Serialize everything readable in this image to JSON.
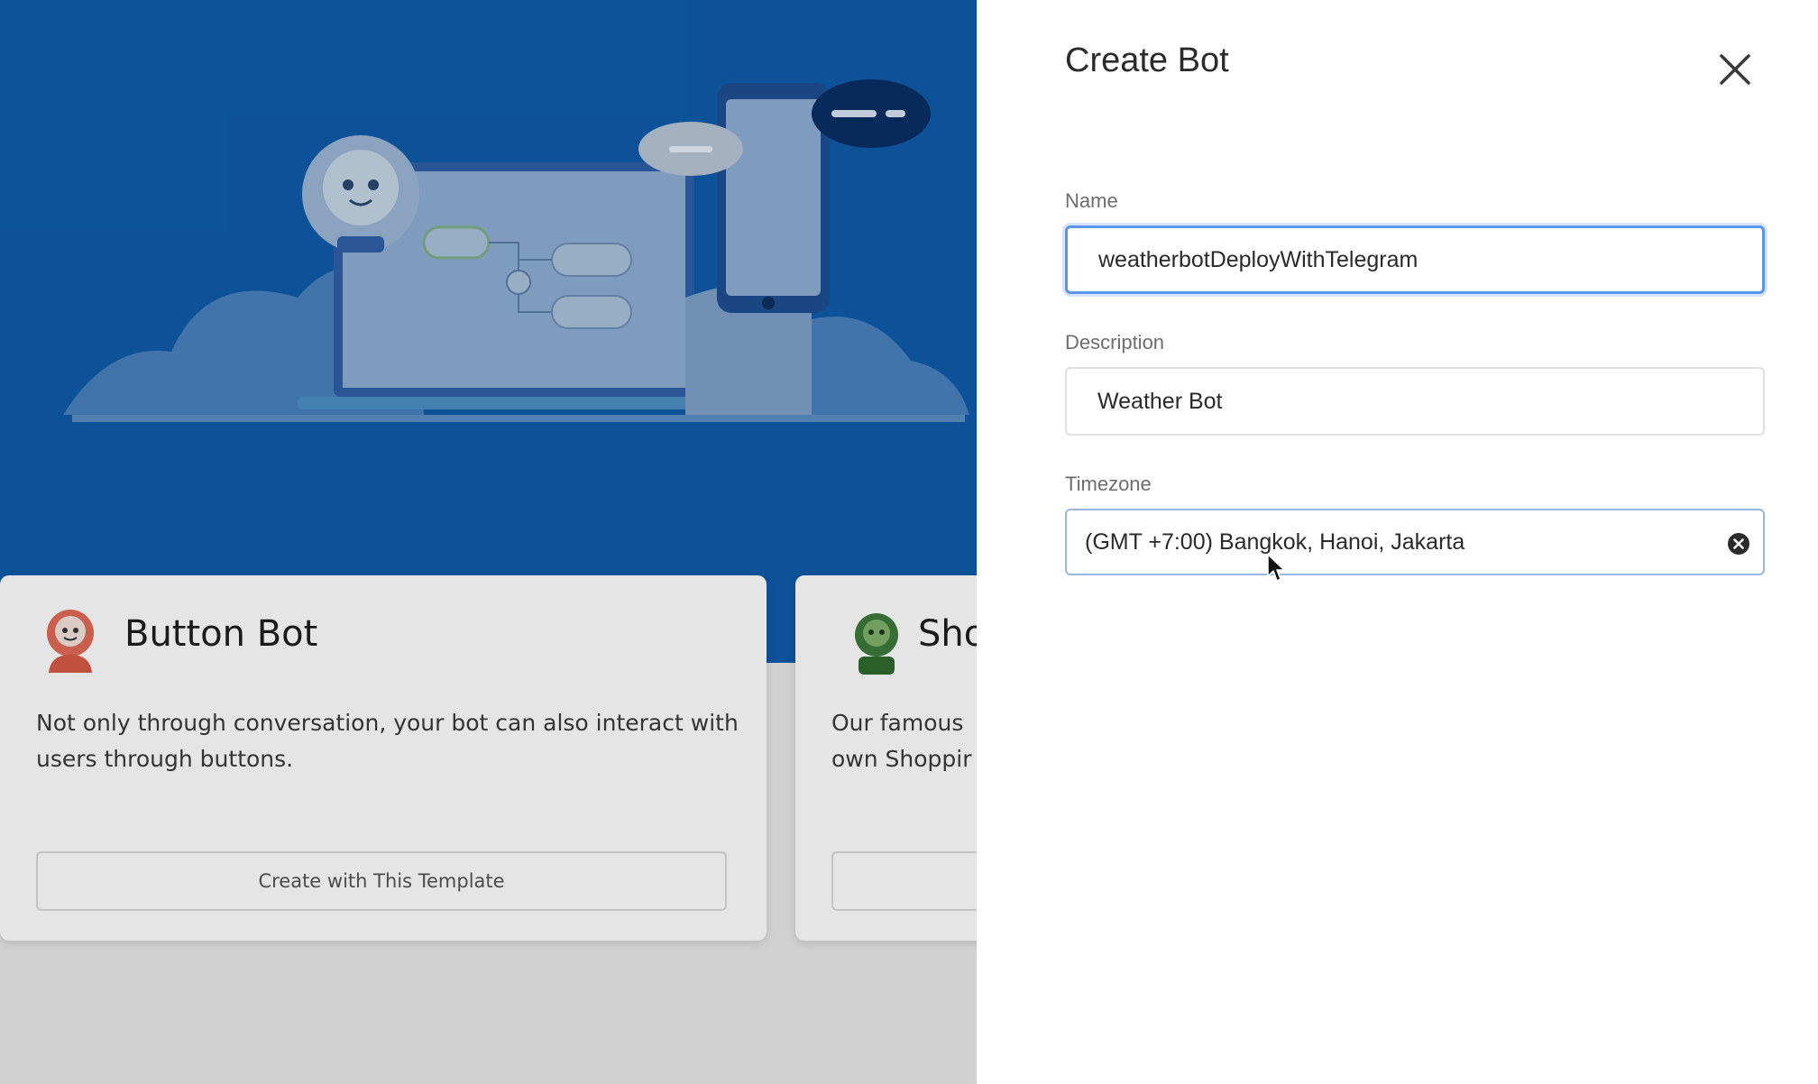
{
  "templates": [
    {
      "title": "Button Bot",
      "description": "Not only through conversation, your bot can also interact with users through buttons.",
      "button_label": "Create with This Template"
    },
    {
      "title": "Sho",
      "description_line1": "Our famous",
      "description_line2": "own Shoppir"
    }
  ],
  "panel": {
    "title": "Create Bot",
    "fields": {
      "name": {
        "label": "Name",
        "value": "weatherbotDeployWithTelegram"
      },
      "description": {
        "label": "Description",
        "value": "Weather Bot"
      },
      "timezone": {
        "label": "Timezone",
        "value": "(GMT +7:00) Bangkok, Hanoi, Jakarta"
      }
    }
  },
  "colors": {
    "hero_blue": "#0f5cab",
    "focus_blue": "#5a95e8"
  },
  "icons": [
    "close-icon",
    "clear-icon",
    "robot-avatar-icon",
    "mouse-cursor-icon"
  ]
}
